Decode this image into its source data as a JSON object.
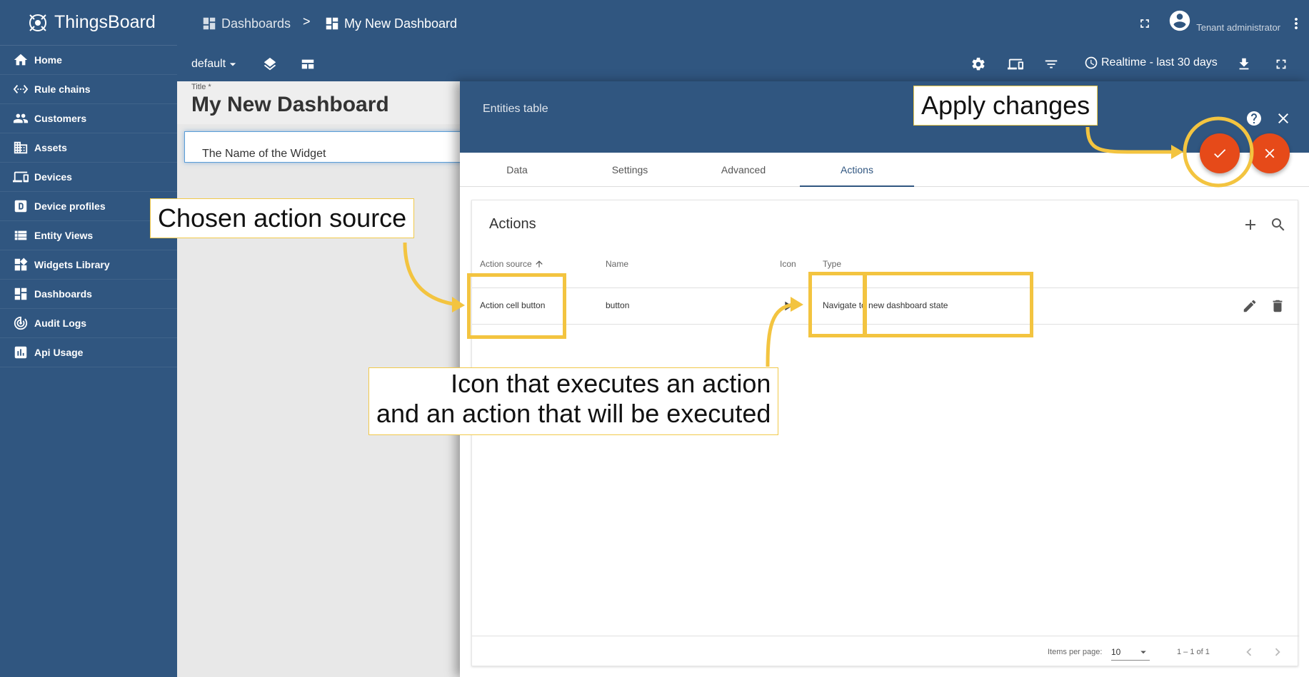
{
  "app": {
    "name": "ThingsBoard"
  },
  "colors": {
    "primary": "#305680",
    "accent": "#e64a19",
    "annotation": "#f3c440"
  },
  "sidebar": {
    "items": [
      {
        "label": "Home",
        "icon": "home-icon"
      },
      {
        "label": "Rule chains",
        "icon": "code-arrows-icon"
      },
      {
        "label": "Customers",
        "icon": "people-icon"
      },
      {
        "label": "Assets",
        "icon": "building-icon"
      },
      {
        "label": "Devices",
        "icon": "devices-icon"
      },
      {
        "label": "Device profiles",
        "icon": "device-profile-icon"
      },
      {
        "label": "Entity Views",
        "icon": "list-view-icon"
      },
      {
        "label": "Widgets Library",
        "icon": "widgets-icon"
      },
      {
        "label": "Dashboards",
        "icon": "dashboard-icon"
      },
      {
        "label": "Audit Logs",
        "icon": "track-changes-icon"
      },
      {
        "label": "Api Usage",
        "icon": "chart-icon"
      }
    ]
  },
  "header": {
    "breadcrumb": [
      "Dashboards",
      "My New Dashboard"
    ],
    "separator": ">",
    "user": "Tenant administrator"
  },
  "toolbar": {
    "layout": "default",
    "timewindow": "Realtime - last 30 days"
  },
  "dashboard": {
    "title_label": "Title *",
    "title": "My New Dashboard",
    "widget_title": "The Name of the Widget"
  },
  "panel": {
    "title": "Entities table",
    "tabs": [
      "Data",
      "Settings",
      "Advanced",
      "Actions"
    ],
    "active_tab": "Actions",
    "actions": {
      "title": "Actions",
      "columns": {
        "source": "Action source",
        "name": "Name",
        "icon": "Icon",
        "type": "Type"
      },
      "rows": [
        {
          "source": "Action cell button",
          "name": "button",
          "icon": "play-arrow-icon",
          "type": "Navigate to new dashboard state"
        }
      ],
      "paging": {
        "items_per_page_label": "Items per page:",
        "items_per_page": "10",
        "range": "1 – 1 of 1"
      }
    }
  },
  "annotations": {
    "apply": "Apply changes",
    "source": "Chosen action source",
    "icon_line1": "Icon that executes an action",
    "icon_line2": "and an action that will be executed"
  }
}
